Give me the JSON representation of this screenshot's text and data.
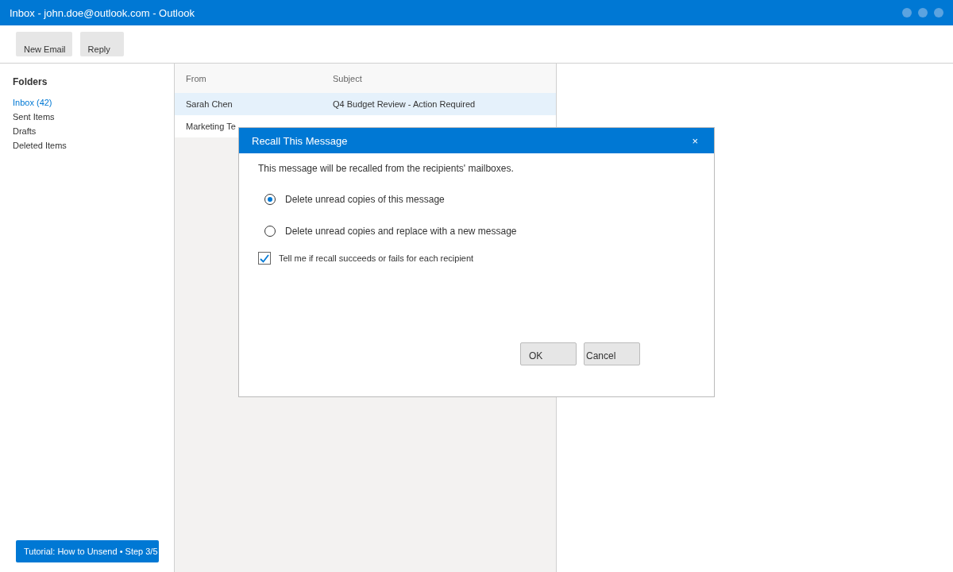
{
  "window": {
    "title": "Inbox - john.doe@outlook.com - Outlook"
  },
  "toolbar": {
    "buttons": [
      "New Email",
      "Reply"
    ]
  },
  "sidebar": {
    "heading": "Folders",
    "items": [
      {
        "label": "Inbox (42)",
        "selected": true
      },
      {
        "label": "Sent Items",
        "selected": false
      },
      {
        "label": "Drafts",
        "selected": false
      },
      {
        "label": "Deleted Items",
        "selected": false
      }
    ]
  },
  "message_list": {
    "columns": [
      "From",
      "Subject"
    ],
    "rows": [
      {
        "from": "Sarah Chen",
        "subject": "Q4 Budget Review - Action Required",
        "selected": true
      },
      {
        "from": "Marketing Te",
        "selected": false
      }
    ]
  },
  "dialog": {
    "title": "Recall This Message",
    "close": "×",
    "intro": "This message will be recalled from the recipients' mailboxes.",
    "options": [
      {
        "label": "Delete unread copies of this message",
        "selected": true
      },
      {
        "label": "Delete unread copies and replace with a new message",
        "selected": false
      }
    ],
    "notify": {
      "label": "Tell me if recall succeeds or fails for each recipient",
      "checked": true
    },
    "buttons": [
      "OK",
      "Cancel"
    ]
  },
  "tutorial_badge": "Tutorial: How to Unsend • Step 3/5"
}
